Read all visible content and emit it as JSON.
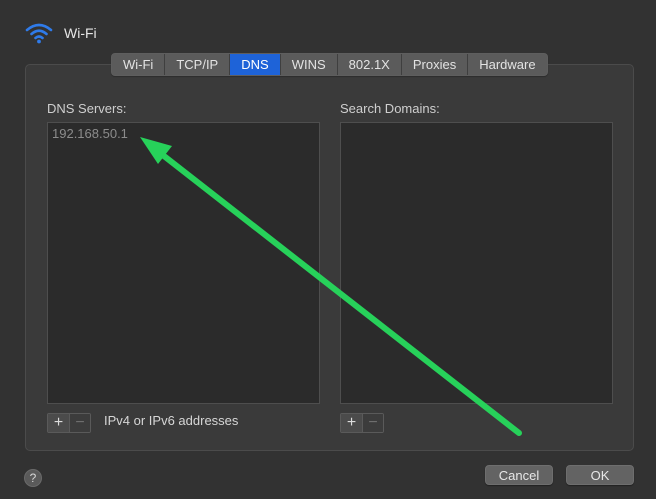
{
  "window": {
    "title": "Wi-Fi",
    "icon": "wifi-icon"
  },
  "tabs": [
    {
      "label": "Wi-Fi",
      "selected": false
    },
    {
      "label": "TCP/IP",
      "selected": false
    },
    {
      "label": "DNS",
      "selected": true
    },
    {
      "label": "WINS",
      "selected": false
    },
    {
      "label": "802.1X",
      "selected": false
    },
    {
      "label": "Proxies",
      "selected": false
    },
    {
      "label": "Hardware",
      "selected": false
    }
  ],
  "dns": {
    "label": "DNS Servers:",
    "servers": [
      "192.168.50.1"
    ],
    "hint": "IPv4 or IPv6 addresses",
    "add_label": "+",
    "remove_label": "−"
  },
  "search": {
    "label": "Search Domains:",
    "domains": [],
    "add_label": "+",
    "remove_label": "−"
  },
  "footer": {
    "help_label": "?",
    "cancel_label": "Cancel",
    "ok_label": "OK"
  },
  "colors": {
    "window_bg": "#323232",
    "tab_selected": "#1e63d8",
    "annotation_arrow": "#27d15a",
    "server_text": "#8c8c8c"
  }
}
